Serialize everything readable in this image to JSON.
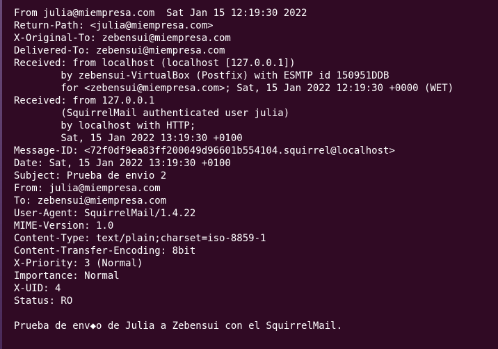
{
  "terminal": {
    "lines": [
      "From julia@miempresa.com  Sat Jan 15 12:19:30 2022",
      "Return-Path: <julia@miempresa.com>",
      "X-Original-To: zebensui@miempresa.com",
      "Delivered-To: zebensui@miempresa.com",
      "Received: from localhost (localhost [127.0.0.1])",
      "        by zebensui-VirtualBox (Postfix) with ESMTP id 150951DDB",
      "        for <zebensui@miempresa.com>; Sat, 15 Jan 2022 12:19:30 +0000 (WET)",
      "Received: from 127.0.0.1",
      "        (SquirrelMail authenticated user julia)",
      "        by localhost with HTTP;",
      "        Sat, 15 Jan 2022 13:19:30 +0100",
      "Message-ID: <72f0df9ea83ff200049d96601b554104.squirrel@localhost>",
      "Date: Sat, 15 Jan 2022 13:19:30 +0100",
      "Subject: Prueba de envio 2",
      "From: julia@miempresa.com",
      "To: zebensui@miempresa.com",
      "User-Agent: SquirrelMail/1.4.22",
      "MIME-Version: 1.0",
      "Content-Type: text/plain;charset=iso-8859-1",
      "Content-Transfer-Encoding: 8bit",
      "X-Priority: 3 (Normal)",
      "Importance: Normal",
      "X-UID: 4",
      "Status: RO",
      "",
      "Prueba de env◆o de Julia a Zebensui con el SquirrelMail."
    ]
  },
  "colors": {
    "background": "#300a24",
    "text": "#ffffff"
  }
}
